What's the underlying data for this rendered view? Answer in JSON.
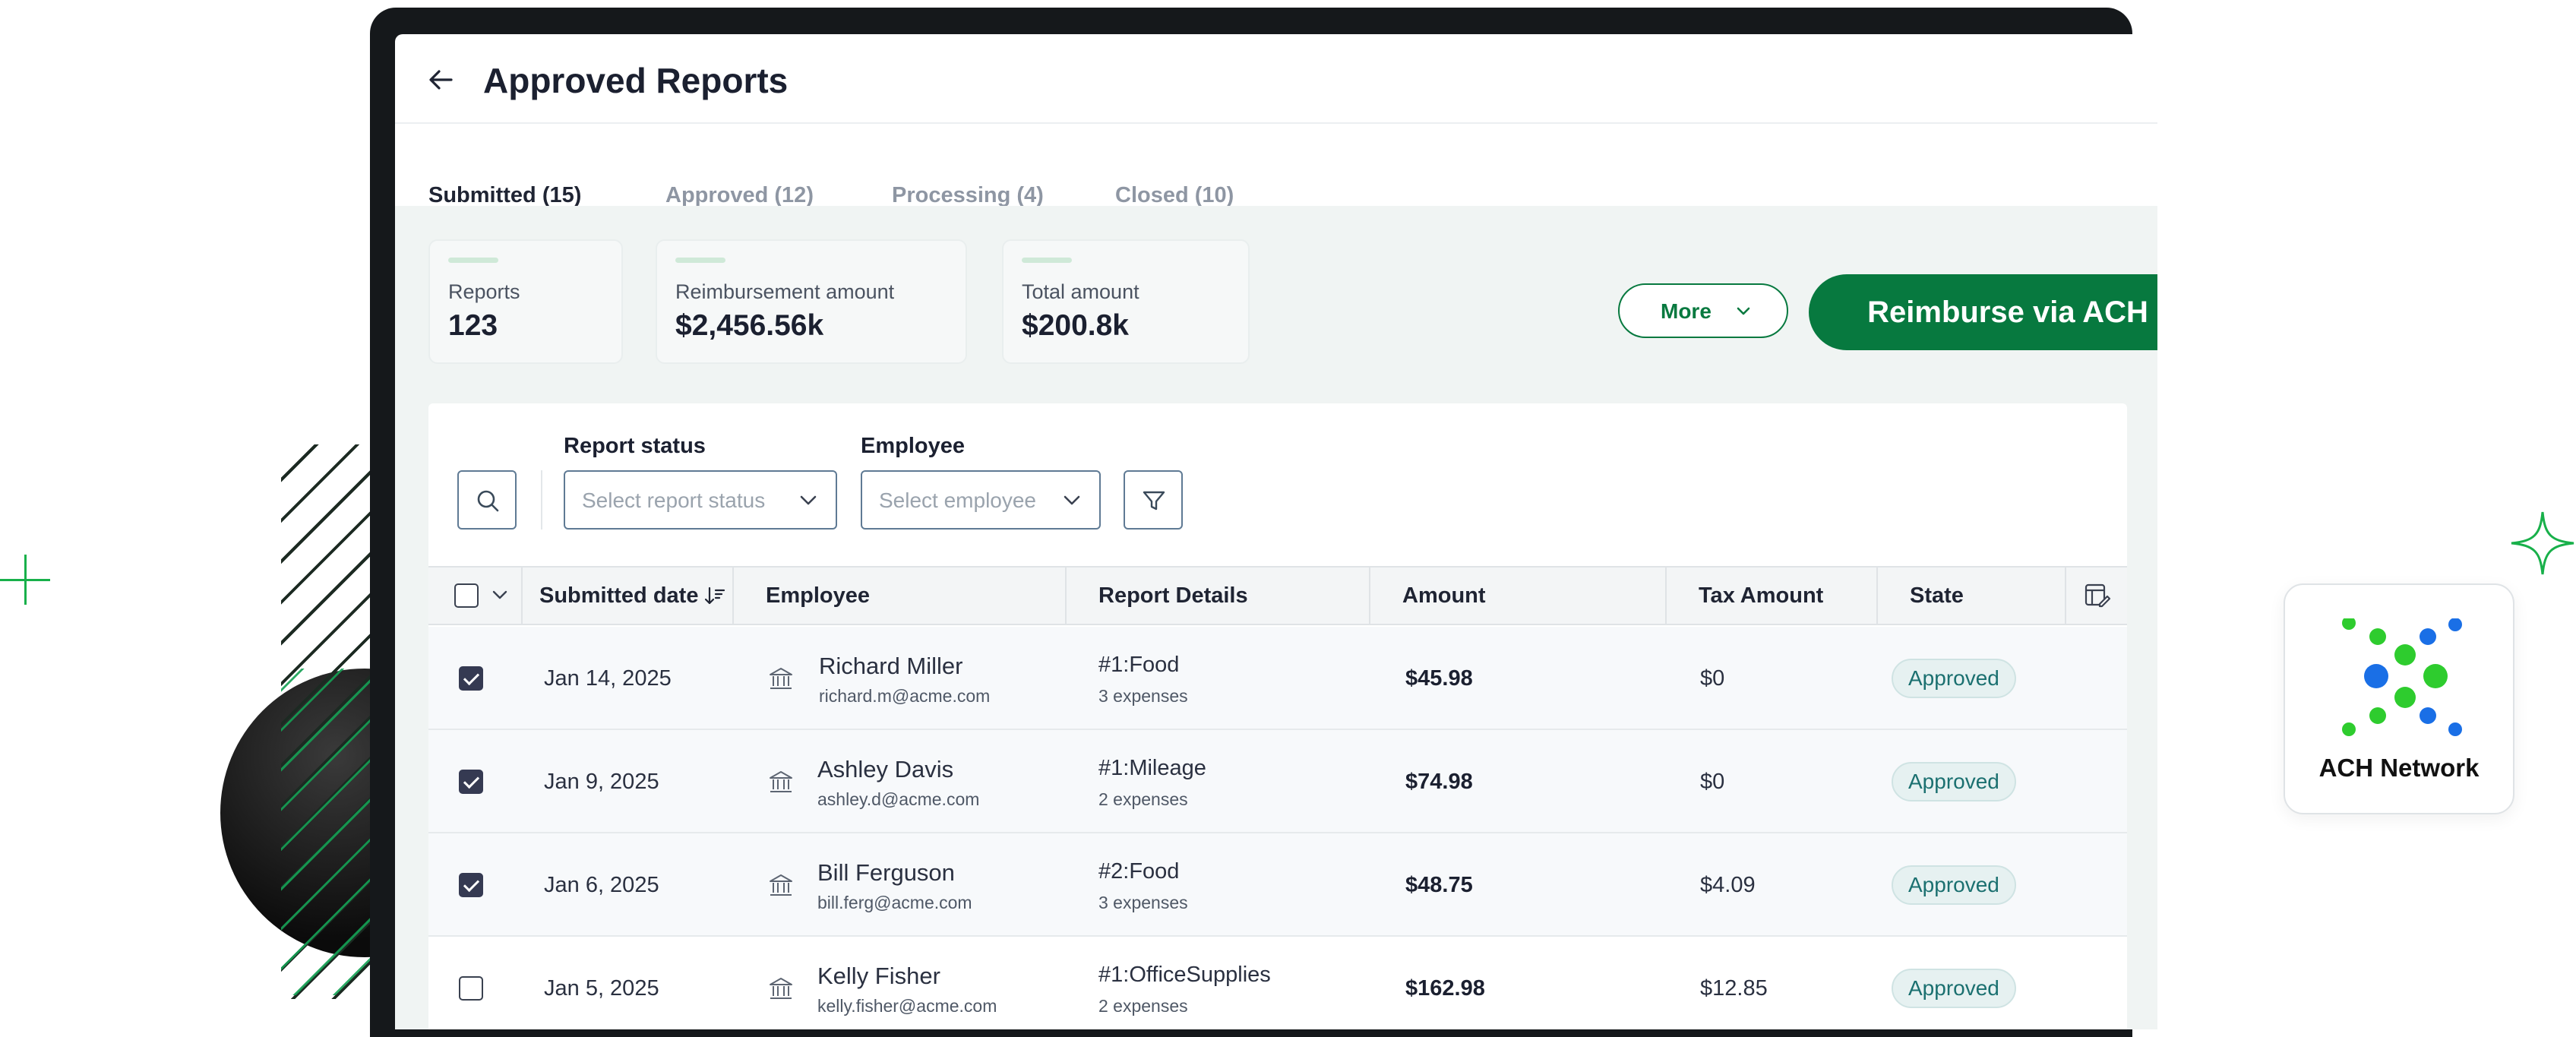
{
  "header": {
    "title": "Approved Reports"
  },
  "tabs": [
    {
      "label": "Submitted (15)",
      "active": true
    },
    {
      "label": "Approved (12)",
      "active": false
    },
    {
      "label": "Processing (4)",
      "active": false
    },
    {
      "label": "Closed (10)",
      "active": false
    }
  ],
  "stats": [
    {
      "label": "Reports",
      "value": "123"
    },
    {
      "label": "Reimbursement amount",
      "value": "$2,456.56k"
    },
    {
      "label": "Total amount",
      "value": "$200.8k"
    }
  ],
  "actions": {
    "more_label": "More",
    "reimburse_label": "Reimburse via ACH"
  },
  "filters": {
    "status_label": "Report status",
    "status_placeholder": "Select report status",
    "employee_label": "Employee",
    "employee_placeholder": "Select employee"
  },
  "table": {
    "columns": [
      "Submitted date",
      "Employee",
      "Report Details",
      "Amount",
      "Tax Amount",
      "State"
    ],
    "rows": [
      {
        "checked": true,
        "date": "Jan 14, 2025",
        "name": "Richard Miller",
        "email": "richard.m@acme.com",
        "report": "#1:Food",
        "expenses": "3 expenses",
        "amount": "$45.98",
        "tax": "$0",
        "state": "Approved"
      },
      {
        "checked": true,
        "date": "Jan 9, 2025",
        "name": "Ashley Davis",
        "email": "ashley.d@acme.com",
        "report": "#1:Mileage",
        "expenses": "2 expenses",
        "amount": "$74.98",
        "tax": "$0",
        "state": "Approved"
      },
      {
        "checked": true,
        "date": "Jan 6, 2025",
        "name": "Bill Ferguson",
        "email": "bill.ferg@acme.com",
        "report": "#2:Food",
        "expenses": "3 expenses",
        "amount": "$48.75",
        "tax": "$4.09",
        "state": "Approved"
      },
      {
        "checked": false,
        "date": "Jan 5, 2025",
        "name": "Kelly Fisher",
        "email": "kelly.fisher@acme.com",
        "report": "#1:OfficeSupplies",
        "expenses": "2 expenses",
        "amount": "$162.98",
        "tax": "$12.85",
        "state": "Approved"
      }
    ]
  },
  "partner_card": {
    "name": "ACH Network"
  },
  "colors": {
    "primary": "#07793f",
    "badge_bg": "#e6f1f1",
    "badge_text": "#1b7070",
    "checkbox": "#353a52"
  },
  "icons": [
    "arrow-left-icon",
    "chevron-down-icon",
    "search-icon",
    "funnel-icon",
    "sort-icon",
    "bank-icon",
    "column-settings-icon"
  ]
}
